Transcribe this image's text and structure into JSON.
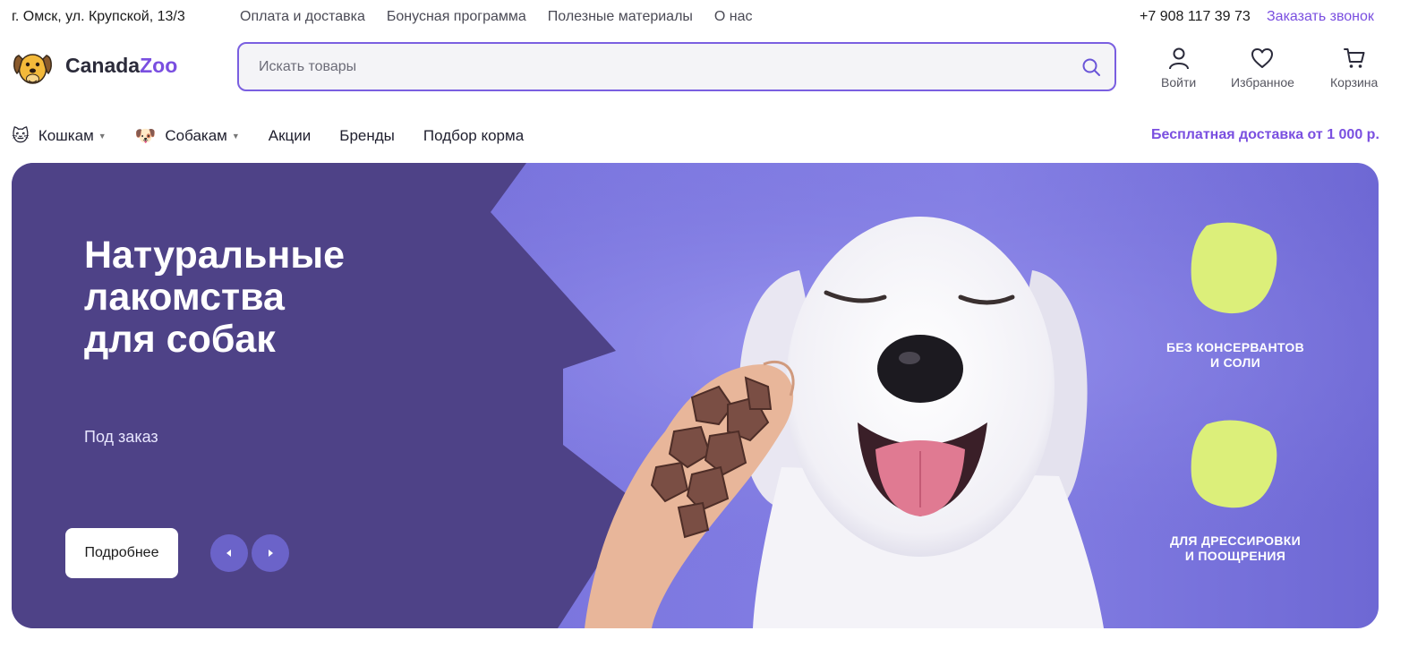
{
  "topbar": {
    "address": "г. Омск, ул. Крупской, 13/3",
    "links": [
      "Оплата и доставка",
      "Бонусная программа",
      "Полезные материалы",
      "О нас"
    ],
    "phone": "+7 908 117 39 73",
    "callback": "Заказать звонок"
  },
  "logo": {
    "part1": "Canada",
    "part2": "Zoo"
  },
  "search": {
    "placeholder": "Искать товары"
  },
  "header_icons": {
    "login": "Войти",
    "favorites": "Избранное",
    "cart": "Корзина"
  },
  "nav": {
    "cats": "Кошкам",
    "dogs": "Собакам",
    "sales": "Акции",
    "brands": "Бренды",
    "food_picker": "Подбор корма",
    "free_delivery": "Бесплатная доставка от 1 000 р."
  },
  "banner": {
    "title_line1": "Натуральные",
    "title_line2": "лакомства",
    "title_line3": "для собак",
    "subtitle": "Под заказ",
    "button": "Подробнее",
    "badge1_line1": "БЕЗ КОНСЕРВАНТОВ",
    "badge1_line2": "И СОЛИ",
    "badge2_line1": "ДЛЯ ДРЕССИРОВКИ",
    "badge2_line2": "И ПООЩРЕНИЯ"
  },
  "colors": {
    "accent": "#7a4fe0",
    "banner_dark": "#4e4287",
    "banner_light": "#7d78e0",
    "badge": "#dcef7a"
  }
}
